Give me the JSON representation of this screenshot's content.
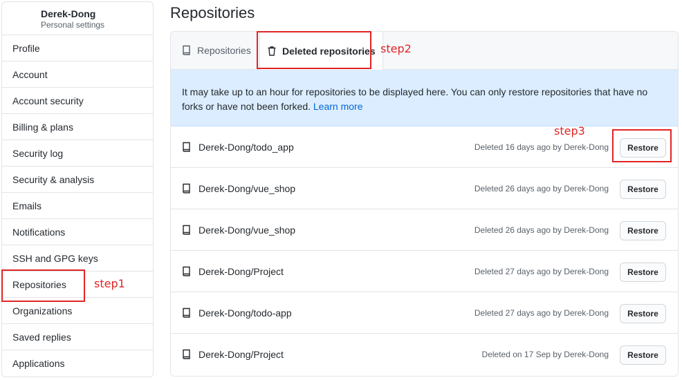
{
  "sidebar": {
    "user_name": "Derek-Dong",
    "user_sub": "Personal settings",
    "items": [
      {
        "label": "Profile"
      },
      {
        "label": "Account"
      },
      {
        "label": "Account security"
      },
      {
        "label": "Billing & plans"
      },
      {
        "label": "Security log"
      },
      {
        "label": "Security & analysis"
      },
      {
        "label": "Emails"
      },
      {
        "label": "Notifications"
      },
      {
        "label": "SSH and GPG keys"
      },
      {
        "label": "Repositories"
      },
      {
        "label": "Organizations"
      },
      {
        "label": "Saved replies"
      },
      {
        "label": "Applications"
      }
    ]
  },
  "main": {
    "title": "Repositories",
    "tabs": [
      {
        "label": "Repositories",
        "icon": "repo-icon"
      },
      {
        "label": "Deleted repositories",
        "icon": "trash-icon"
      }
    ],
    "flash": {
      "text": "It may take up to an hour for repositories to be displayed here. You can only restore repositories that have no forks or have not been forked.",
      "link": "Learn more"
    },
    "restore_label": "Restore",
    "rows": [
      {
        "name": "Derek-Dong/todo_app",
        "meta": "Deleted 16 days ago by Derek-Dong"
      },
      {
        "name": "Derek-Dong/vue_shop",
        "meta": "Deleted 26 days ago by Derek-Dong"
      },
      {
        "name": "Derek-Dong/vue_shop",
        "meta": "Deleted 26 days ago by Derek-Dong"
      },
      {
        "name": "Derek-Dong/Project",
        "meta": "Deleted 27 days ago by Derek-Dong"
      },
      {
        "name": "Derek-Dong/todo-app",
        "meta": "Deleted 27 days ago by Derek-Dong"
      },
      {
        "name": "Derek-Dong/Project",
        "meta": "Deleted on 17 Sep by Derek-Dong"
      }
    ]
  },
  "annotations": {
    "step1": "step1",
    "step2": "step2",
    "step3": "step3",
    "color": "#e02424"
  },
  "colors": {
    "link": "#0366d6",
    "flash_bg": "#dbedff",
    "border": "#e1e4e8"
  }
}
